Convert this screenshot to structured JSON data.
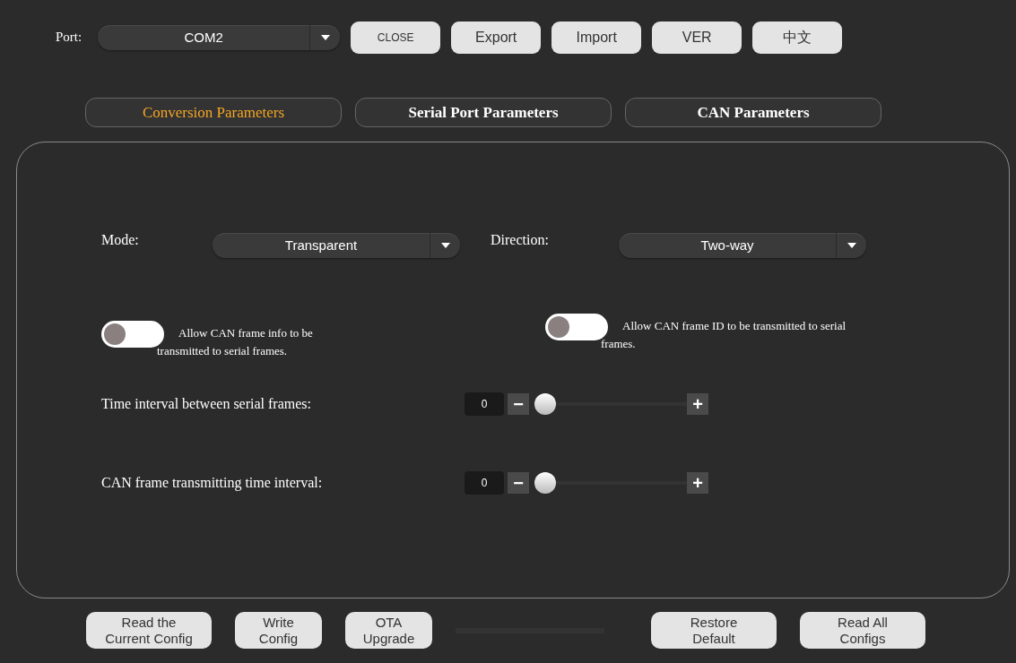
{
  "port": {
    "label": "Port:",
    "value": "COM2"
  },
  "top_buttons": [
    "CLOSE",
    "Export",
    "Import",
    "VER",
    "中文"
  ],
  "tabs": [
    {
      "label": "Conversion Parameters",
      "selected": true
    },
    {
      "label": "Serial Port Parameters",
      "selected": false
    },
    {
      "label": "CAN Parameters",
      "selected": false
    }
  ],
  "selects": [
    {
      "label": "Mode:",
      "value": "Transparent"
    },
    {
      "label": "Direction:",
      "value": "Two-way"
    }
  ],
  "toggles": [
    {
      "label": "Allow CAN frame info to be transmitted to serial frames.",
      "on": false
    },
    {
      "label": "Allow CAN frame ID to be transmitted to serial frames.",
      "on": false
    }
  ],
  "sliders": [
    {
      "label": "Time interval between serial frames:",
      "value": "0",
      "level": 0,
      "minus": "−",
      "plus": "+"
    },
    {
      "label": "CAN frame transmitting time interval:",
      "value": "0",
      "level": 0,
      "minus": "−",
      "plus": "+"
    }
  ],
  "bottom_buttons": [
    {
      "label": "Read the Current Config"
    },
    {
      "label": "Write Config"
    },
    {
      "label": "OTA Upgrade"
    },
    {
      "kind": "progress",
      "level": 0
    },
    {
      "label": "Restore Default"
    },
    {
      "label": "Read All Configs"
    }
  ]
}
